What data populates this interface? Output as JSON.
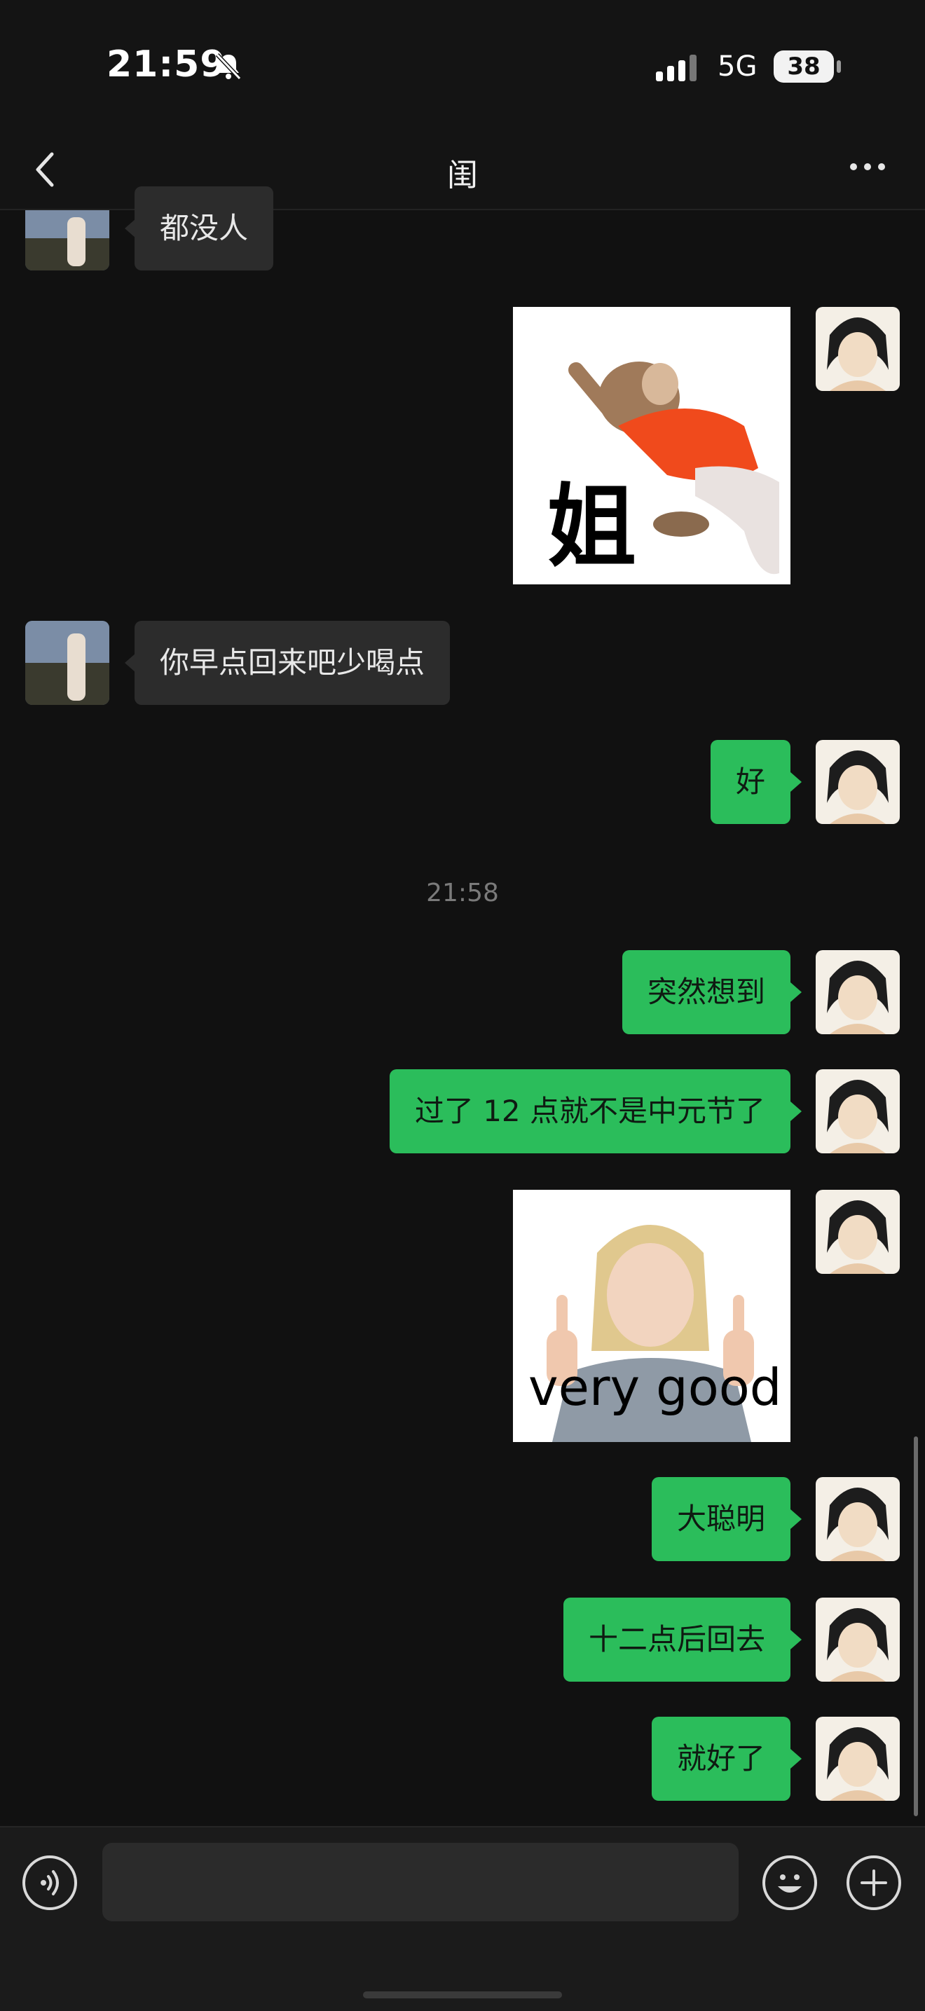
{
  "status": {
    "time": "21:59",
    "network": "5G",
    "battery": "38"
  },
  "header": {
    "title": "闺"
  },
  "messages": {
    "m1": "都没人",
    "m2": "你早点回来吧少喝点",
    "m3": "好",
    "timestamp": "21:58",
    "m4": "突然想到",
    "m5": "过了 12 点就不是中元节了",
    "m6": "大聪明",
    "m7": "十二点后回去",
    "m8": "就好了"
  },
  "stickers": {
    "s1_text": "姐",
    "s2_text": "very good"
  },
  "input": {
    "placeholder": ""
  },
  "colors": {
    "bubble_mine": "#2bbd5b",
    "bubble_other": "#2c2c2c",
    "background": "#111111"
  }
}
